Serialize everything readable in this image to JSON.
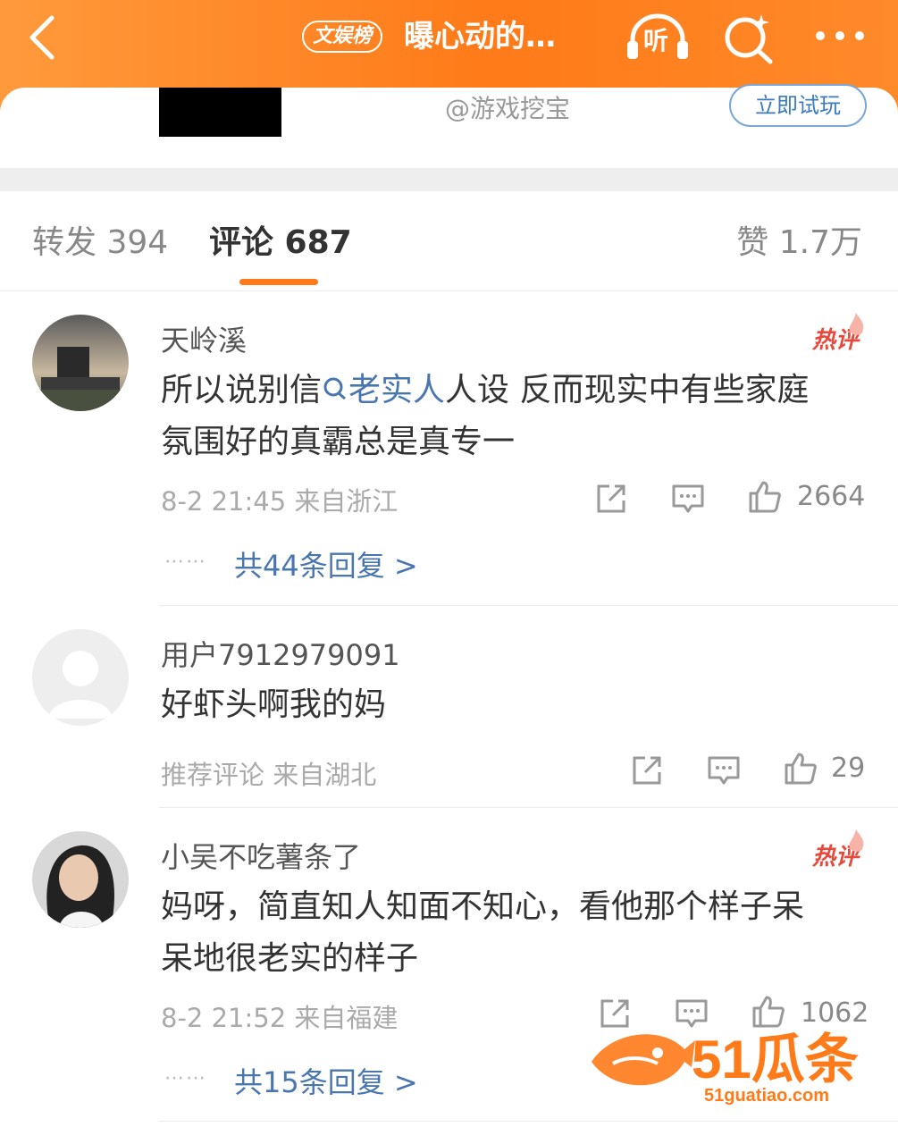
{
  "header": {
    "badge": "文娱榜",
    "title": "曝心动的…",
    "listen_label": "听"
  },
  "ad": {
    "source": "@游戏挖宝",
    "try_label": "立即试玩"
  },
  "tabs": {
    "repost": "转发 394",
    "comment": "评论 687",
    "like": "赞 1.7万"
  },
  "comments": [
    {
      "username": "天岭溪",
      "hot": "热评",
      "text_prefix": "所以说别信",
      "text_link": "老实人",
      "text_rest_line1": "人设 反而现实中有些家庭",
      "text_line2": "氛围好的真霸总是真专一",
      "meta": "8-2 21:45 来自浙江",
      "likes": "2664",
      "dots": "⋯⋯",
      "replies": "共44条回复 >"
    },
    {
      "username": "用户7912979091",
      "text": "好虾头啊我的妈",
      "meta": "推荐评论 来自湖北",
      "likes": "29"
    },
    {
      "username": "小吴不吃薯条了",
      "hot": "热评",
      "text_line1": "妈呀，简直知人知面不知心，看他那个样子呆",
      "text_line2": "呆地很老实的样子",
      "meta": "8-2 21:52 来自福建",
      "likes": "1062",
      "dots": "⋯⋯",
      "replies": "共15条回复 >"
    }
  ],
  "watermark": {
    "brand": "51瓜条",
    "url": "51guatiao.com"
  },
  "colors": {
    "header_orange": "#ff7a18",
    "link_blue": "#4a76b0",
    "hot_red": "#e8483a"
  },
  "icons": [
    "back-arrow-icon",
    "headphones-icon",
    "search-sparkle-icon",
    "more-dots-icon",
    "share-icon",
    "comment-icon",
    "thumbs-up-icon",
    "flame-icon"
  ]
}
